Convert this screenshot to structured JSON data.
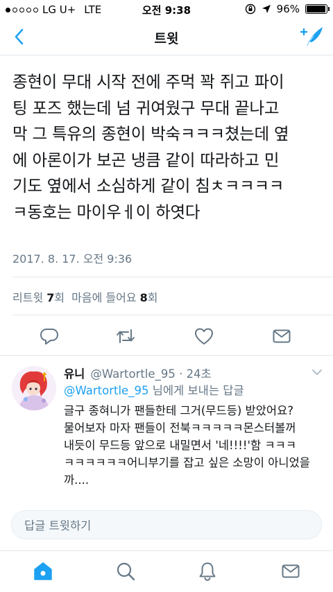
{
  "status_bar": {
    "carrier": "LG U+",
    "network": "LTE",
    "time": "오전 9:38",
    "battery_text": "96%",
    "battery_level": 0.96
  },
  "nav": {
    "title": "트윗",
    "back_icon": "chevron-left-icon",
    "compose_icon": "compose-tweet-icon"
  },
  "tweet": {
    "lines": [
      "종현이 무대 시작 전에 주먹 꽉 쥐고 파이",
      "팅 포즈 했는데 넘 귀여웠구 무대 끝나고",
      "막 그 특유의 종현이 박숙ㅋㅋㅋ쳤는데 옆",
      "에 아론이가 보곤 냉큼 같이 따라하고 민",
      "기도 옆에서 소심하게 같이 침ㅊㅋㅋㅋㅋ",
      "ㅋ동호는 마이우ㅔ이 하엿다"
    ],
    "timestamp": "2017. 8. 17. 오전 9:36",
    "retweet_label": "리트윗",
    "retweet_count": "7",
    "retweet_unit": "회",
    "like_label": "마음에 들어요",
    "like_count": "8",
    "like_unit": "회"
  },
  "actions": [
    "reply-icon",
    "retweet-icon",
    "like-icon",
    "message-icon"
  ],
  "reply": {
    "name": "유니",
    "handle_time": "@Wartortle_95 · 24초",
    "reply_to_mention": "@Wartortle_95",
    "reply_to_suffix": " 님에게 보내는 답글",
    "lines": [
      "글구 종혀니가 팬들한테 그거(무드등) 받았어요?",
      "물어보자 마자 팬들이 전북ㅋㅋㅋㅋㅋ몬스터볼꺼",
      "내듯이 무드등 앞으로 내밀면서 '네!!!!'함 ㅋㅋㅋ",
      "ㅋㅋㅋㅋㅋㅋ어니부기를 잡고 싶은 소망이 아니었을",
      "까...."
    ]
  },
  "composer": {
    "placeholder": "답글 트윗하기"
  },
  "tabbar": [
    "home-icon",
    "search-icon",
    "notifications-icon",
    "messages-icon"
  ],
  "colors": {
    "accent": "#1da1f2",
    "secondary_text": "#657786",
    "primary_text": "#14171a",
    "divider": "#e1e8ed"
  }
}
